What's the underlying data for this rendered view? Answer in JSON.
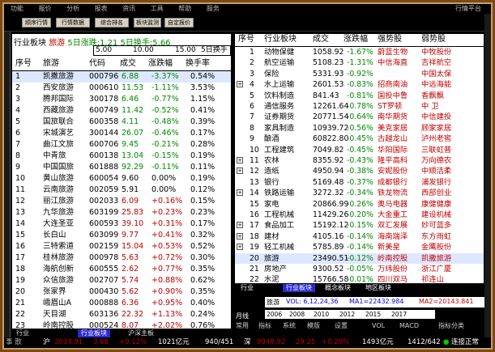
{
  "menu": {
    "items": [
      "功能",
      "报价",
      "分析",
      "报表",
      "资讯",
      "工具",
      "帮助",
      "服务"
    ],
    "right": "行情平台"
  },
  "toolbar": {
    "buttons": [
      "顺序行情",
      "行情数据",
      "综合排名",
      "板块监测",
      "自定报价"
    ]
  },
  "left_panel": {
    "info_sector": "行业板块",
    "info_name": "旅游",
    "info_text": "5日涨跌:1.21 5日换手:5.66",
    "info_values": [
      "5.00",
      "10.00",
      "15.00",
      "5日换手"
    ],
    "headers": [
      "序号",
      "旅游",
      "代码",
      "成交",
      "涨跌幅",
      "换手率"
    ],
    "rows": [
      {
        "n": "1",
        "name": "凯撒旅游",
        "code": "000796",
        "price": "6.88",
        "chg": "-3.37%",
        "turn": "0.54%",
        "dir": "down"
      },
      {
        "n": "2",
        "name": "西安旅游",
        "code": "000610",
        "price": "11.53",
        "chg": "-1.11%",
        "turn": "3.53%",
        "dir": "down"
      },
      {
        "n": "3",
        "name": "腾邦国际",
        "code": "300178",
        "price": "6.46",
        "chg": "-0.77%",
        "turn": "1.15%",
        "dir": "down"
      },
      {
        "n": "4",
        "name": "西藏旅游",
        "code": "600749",
        "price": "11.42",
        "chg": "-0.52%",
        "turn": "0.41%",
        "dir": "down"
      },
      {
        "n": "5",
        "name": "国旅联合",
        "code": "600358",
        "price": "4.11",
        "chg": "-0.48%",
        "turn": "0.39%",
        "dir": "down"
      },
      {
        "n": "6",
        "name": "宋城演艺",
        "code": "300144",
        "price": "26.07",
        "chg": "-0.46%",
        "turn": "0.17%",
        "dir": "down"
      },
      {
        "n": "7",
        "name": "曲江文旅",
        "code": "600706",
        "price": "9.45",
        "chg": "-0.21%",
        "turn": "0.28%",
        "dir": "down"
      },
      {
        "n": "8",
        "name": "中青旅",
        "code": "600138",
        "price": "13.04",
        "chg": "-0.15%",
        "turn": "0.19%",
        "dir": "down"
      },
      {
        "n": "9",
        "name": "中国国旅",
        "code": "601888",
        "price": "92.29",
        "chg": "-0.11%",
        "turn": "0.11%",
        "dir": "down"
      },
      {
        "n": "10",
        "name": "黄山旅游",
        "code": "600054",
        "price": "9.60",
        "chg": "0.00%",
        "turn": "0.19%",
        "dir": "flat"
      },
      {
        "n": "11",
        "name": "云南旅游",
        "code": "002059",
        "price": "5.91",
        "chg": "0.00%",
        "turn": "0.12%",
        "dir": "flat"
      },
      {
        "n": "12",
        "name": "丽江旅游",
        "code": "002033",
        "price": "6.09",
        "chg": "+0.16%",
        "turn": "0.15%",
        "dir": "up"
      },
      {
        "n": "13",
        "name": "九华旅游",
        "code": "603199",
        "price": "25.83",
        "chg": "+0.23%",
        "turn": "0.23%",
        "dir": "up"
      },
      {
        "n": "14",
        "name": "大连圣亚",
        "code": "600593",
        "price": "39.10",
        "chg": "+0.31%",
        "turn": "0.17%",
        "dir": "up"
      },
      {
        "n": "15",
        "name": "长白山",
        "code": "603099",
        "price": "9.77",
        "chg": "+0.41%",
        "turn": "0.32%",
        "dir": "up"
      },
      {
        "n": "16",
        "name": "三特索道",
        "code": "002159",
        "price": "15.04",
        "chg": "+0.53%",
        "turn": "0.52%",
        "dir": "up"
      },
      {
        "n": "17",
        "name": "桂林旅游",
        "code": "000978",
        "price": "5.63",
        "chg": "+0.72%",
        "turn": "0.30%",
        "dir": "up"
      },
      {
        "n": "18",
        "name": "海航创新",
        "code": "600555",
        "price": "2.62",
        "chg": "+0.77%",
        "turn": "0.35%",
        "dir": "up"
      },
      {
        "n": "19",
        "name": "众信旅游",
        "code": "002707",
        "price": "5.74",
        "chg": "+0.88%",
        "turn": "0.62%",
        "dir": "up"
      },
      {
        "n": "20",
        "name": "张家界",
        "code": "000430",
        "price": "5.62",
        "chg": "+0.90%",
        "turn": "0.35%",
        "dir": "up"
      },
      {
        "n": "21",
        "name": "峨眉山A",
        "code": "000888",
        "price": "6.36",
        "chg": "+0.95%",
        "turn": "0.40%",
        "dir": "up"
      },
      {
        "n": "22",
        "name": "天目湖",
        "code": "603136",
        "price": "22.32",
        "chg": "+1.13%",
        "turn": "0.24%",
        "dir": "up"
      },
      {
        "n": "23",
        "name": "岭南控股",
        "code": "000524",
        "price": "8.07",
        "chg": "+2.02%",
        "turn": "0.76%",
        "dir": "up"
      }
    ],
    "tabs": [
      "行业",
      "行业板块",
      "沪深主板"
    ]
  },
  "right_panel": {
    "headers": [
      "序号",
      "行业板块",
      "成交",
      "涨跌幅",
      "强势股",
      "弱势股"
    ],
    "rows": [
      {
        "n": "1",
        "name": "动物保健",
        "vol": "1058.92",
        "chg": "-1.67%",
        "strong": "蔚蓝生物",
        "weak": "中牧股份",
        "dir": "down"
      },
      {
        "n": "2",
        "name": "航空运输",
        "vol": "5108.23",
        "chg": "-1.31%",
        "strong": "中信海直",
        "weak": "吉祥航空",
        "dir": "down"
      },
      {
        "n": "3",
        "name": "保险",
        "vol": "5331.93",
        "chg": "-0.92%",
        "strong": "",
        "weak": "中国太保",
        "dir": "down"
      },
      {
        "n": "4",
        "name": "水上运输",
        "vol": "2601.53",
        "chg": "-0.83%",
        "strong": "招商南油",
        "weak": "中远海能",
        "dir": "down"
      },
      {
        "n": "5",
        "name": "饮料制造",
        "vol": "841.43",
        "chg": "-0.81%",
        "strong": "国投中鲁",
        "weak": "香飘飘",
        "dir": "down"
      },
      {
        "n": "6",
        "name": "通信服务",
        "vol": "12261.64",
        "chg": "-0.78%",
        "strong": "ST罗顿",
        "weak": "中 卫",
        "dir": "down"
      },
      {
        "n": "7",
        "name": "证券期货",
        "vol": "20771.54",
        "chg": "-0.64%",
        "strong": "南华期货",
        "weak": "中信建投",
        "dir": "down"
      },
      {
        "n": "8",
        "name": "家具制造",
        "vol": "10939.72",
        "chg": "-0.56%",
        "strong": "美克家居",
        "weak": "顾家家居",
        "dir": "down"
      },
      {
        "n": "9",
        "name": "酿酒",
        "vol": "60822.80",
        "chg": "-0.45%",
        "strong": "古越龙山",
        "weak": "泸州老窖",
        "dir": "down"
      },
      {
        "n": "10",
        "name": "工程建筑",
        "vol": "7049.82",
        "chg": "-0.45%",
        "strong": "华阳国际",
        "weak": "三联虹普",
        "dir": "down"
      },
      {
        "n": "11",
        "name": "农林",
        "vol": "8355.92",
        "chg": "-0.43%",
        "strong": "隆平高科",
        "weak": "万向德农",
        "dir": "down"
      },
      {
        "n": "12",
        "name": "造纸",
        "vol": "4950.94",
        "chg": "-0.38%",
        "strong": "安妮股份",
        "weak": "中顺洁柔",
        "dir": "down"
      },
      {
        "n": "13",
        "name": "银行",
        "vol": "5169.48",
        "chg": "-0.37%",
        "strong": "成都银行",
        "weak": "浦发银行",
        "dir": "down"
      },
      {
        "n": "14",
        "name": "铁路运输",
        "vol": "3272.32",
        "chg": "-0.34%",
        "strong": "铁龙物流",
        "weak": "西部创业",
        "dir": "down"
      },
      {
        "n": "15",
        "name": "家电",
        "vol": "20866.99",
        "chg": "-0.26%",
        "strong": "奥马电器",
        "weak": "康健健康",
        "dir": "down"
      },
      {
        "n": "16",
        "name": "工程机械",
        "vol": "11429.26",
        "chg": "-0.20%",
        "strong": "大金重工",
        "weak": "建设机械",
        "dir": "down"
      },
      {
        "n": "17",
        "name": "食品加工",
        "vol": "15192.12",
        "chg": "-0.15%",
        "strong": "双汇发展",
        "weak": "妙可蓝多",
        "dir": "down"
      },
      {
        "n": "18",
        "name": "建材",
        "vol": "4105.16",
        "chg": "-0.14%",
        "strong": "海南瑞泽",
        "weak": "东方雨虹",
        "dir": "down"
      },
      {
        "n": "19",
        "name": "轻工机械",
        "vol": "5785.89",
        "chg": "-0.14%",
        "strong": "新美星",
        "weak": "金鹰股份",
        "dir": "down"
      },
      {
        "n": "20",
        "name": "旅游",
        "vol": "23490.51",
        "chg": "-0.12%",
        "strong": "岭南控股",
        "weak": "凯撒旅游",
        "dir": "down"
      },
      {
        "n": "21",
        "name": "房地产",
        "vol": "9300.52",
        "chg": "-0.05%",
        "strong": "万纬股份",
        "weak": "浙江广厦",
        "dir": "down"
      },
      {
        "n": "22",
        "name": "水泥",
        "vol": "15766.58",
        "chg": "-0.01%",
        "strong": "四川双马",
        "weak": "祁连山",
        "dir": "down"
      }
    ],
    "tabs": [
      "行业",
      "行业板块",
      "概念板块",
      "地区板块"
    ]
  },
  "indicator": {
    "label": "旅游",
    "vol": "VOL: 6,12,24,36",
    "ma1": "MA1=22432.984",
    "ma2": "MA2=20143.841",
    "years": [
      "2006",
      "2008",
      "2010",
      "2012",
      "2015",
      "2017"
    ],
    "line_label": "月线",
    "bar_items": [
      "常用",
      "指标",
      "系统",
      "模版",
      "设置",
      "VOL",
      "MACD",
      "指标分类"
    ]
  },
  "status": {
    "sh_label": "沪",
    "sh_index": "3034.91",
    "sh_chg": "3.68",
    "sh_pct": "+0.12%",
    "sh_amt": "1021亿元",
    "sh_ud": "940/451",
    "sz_label": "深",
    "sz_index": "9948.92",
    "sz_chg": "29.25",
    "sz_pct": "+0.29%",
    "sz_amt": "1493亿元",
    "sz_ud": "1412/642",
    "conn": "连接正常",
    "left_label": "事 散"
  },
  "colors": {
    "up": "#c00000",
    "down": "#008800",
    "flat": "#000000",
    "selected": "#dde8ff",
    "frame": "#caa05a",
    "tab_active": "#2a2ad0"
  }
}
